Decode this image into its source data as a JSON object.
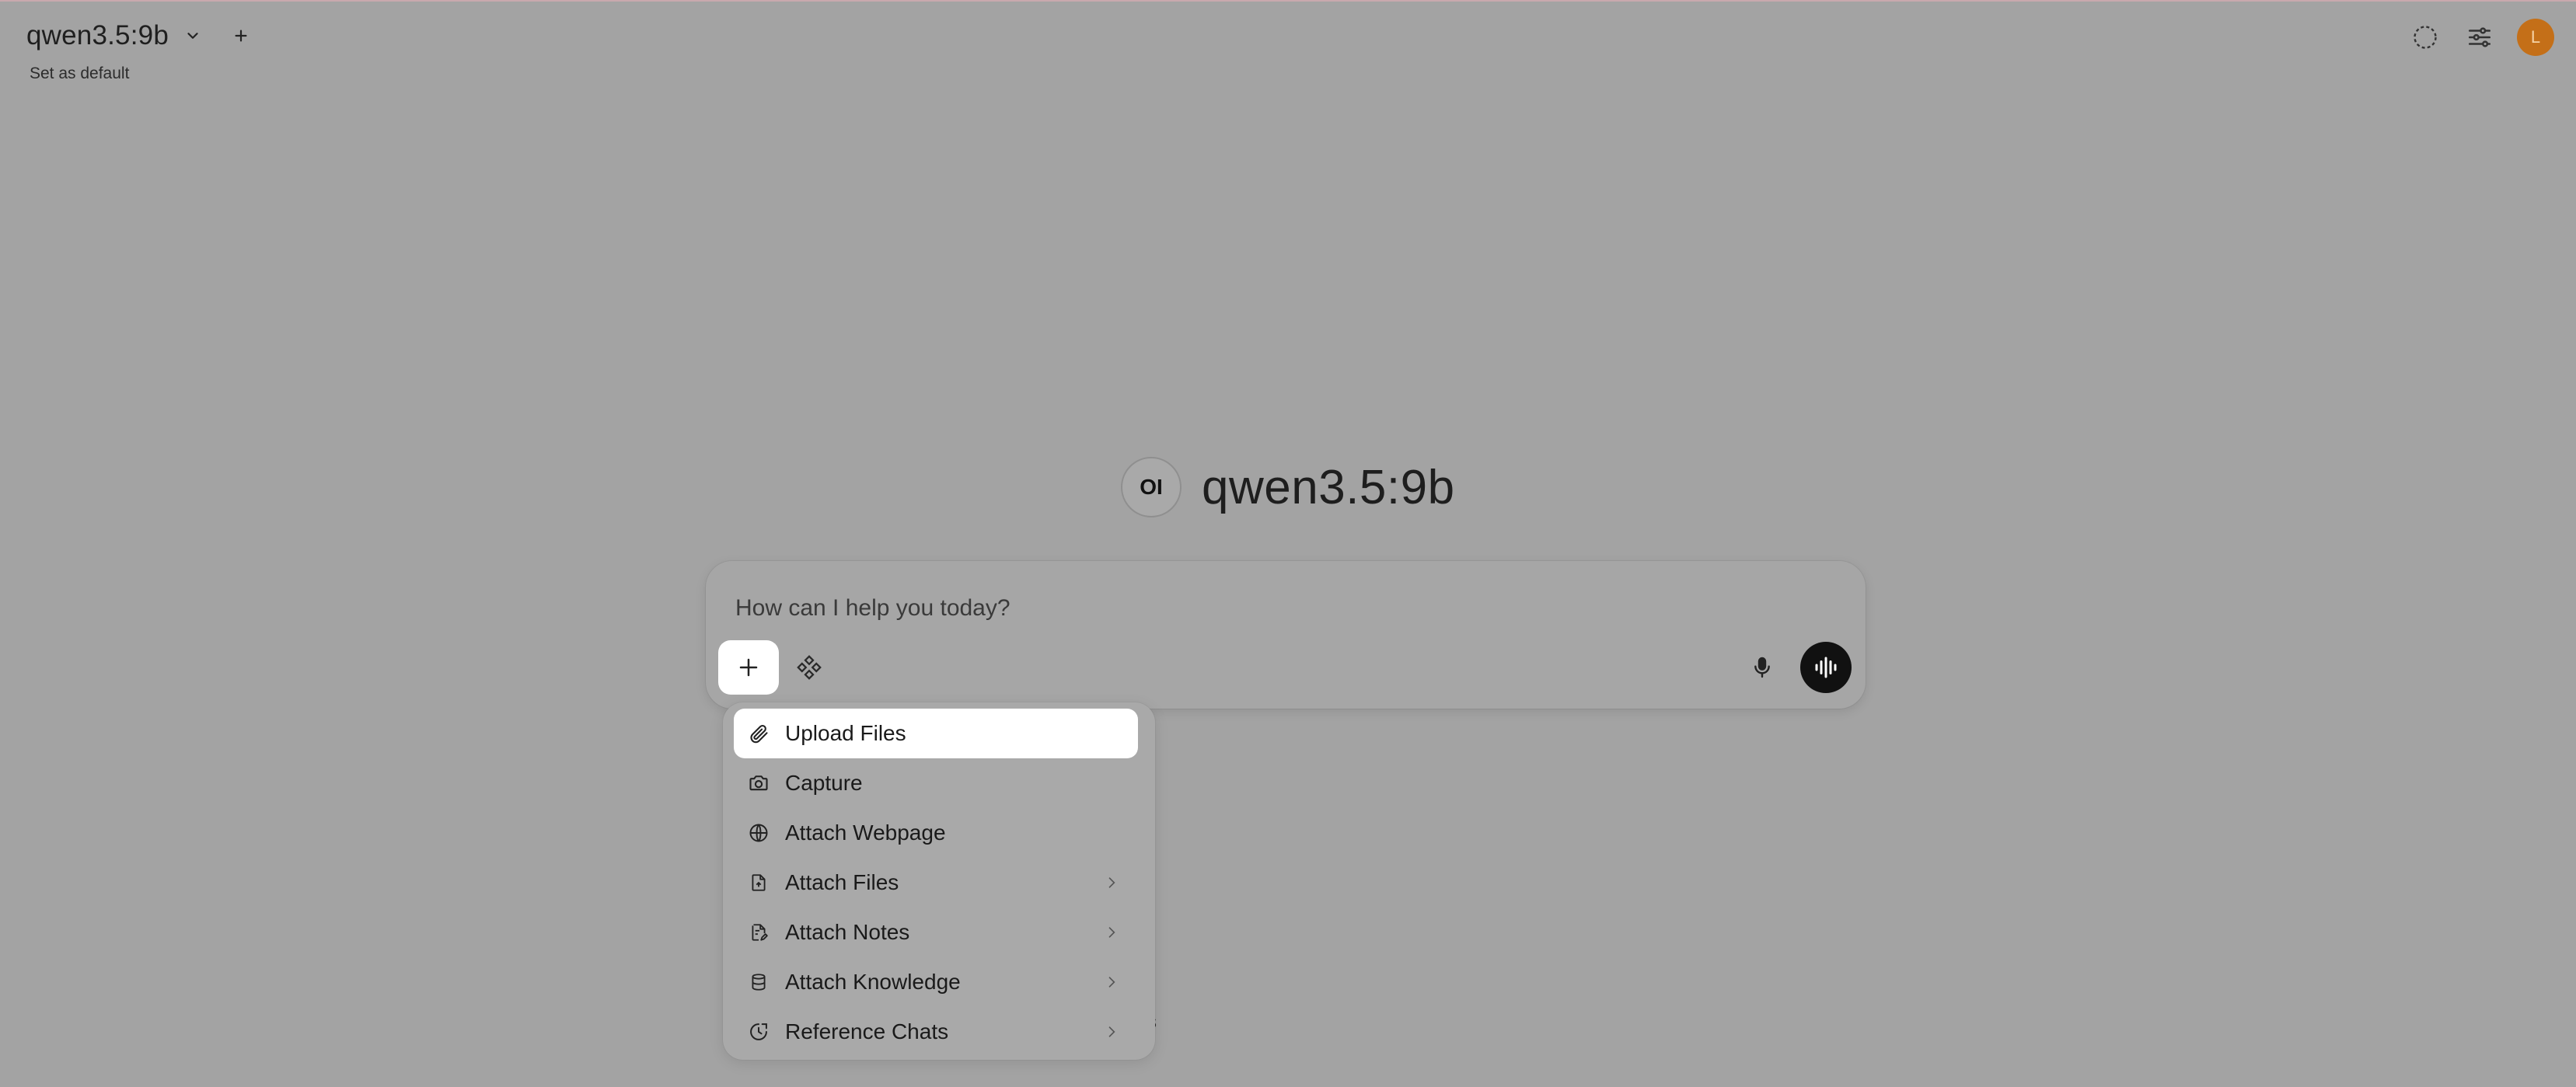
{
  "header": {
    "model_name": "qwen3.5:9b",
    "set_default": "Set as default",
    "avatar_initial": "L"
  },
  "hero": {
    "logo_text": "OI",
    "title": "qwen3.5:9b"
  },
  "prompt": {
    "placeholder": "How can I help you today?"
  },
  "menu": {
    "items": [
      {
        "label": "Upload Files",
        "icon": "paperclip-icon",
        "has_submenu": false
      },
      {
        "label": "Capture",
        "icon": "camera-icon",
        "has_submenu": false
      },
      {
        "label": "Attach Webpage",
        "icon": "globe-icon",
        "has_submenu": false
      },
      {
        "label": "Attach Files",
        "icon": "file-icon",
        "has_submenu": true
      },
      {
        "label": "Attach Notes",
        "icon": "note-icon",
        "has_submenu": true
      },
      {
        "label": "Attach Knowledge",
        "icon": "database-icon",
        "has_submenu": true
      },
      {
        "label": "Reference Chats",
        "icon": "chat-history-icon",
        "has_submenu": true
      }
    ]
  },
  "background_fragment": "s",
  "colors": {
    "background": "#a3a3a3",
    "avatar": "#c46f18",
    "voice_button": "#111111",
    "active_item": "#ffffff"
  }
}
